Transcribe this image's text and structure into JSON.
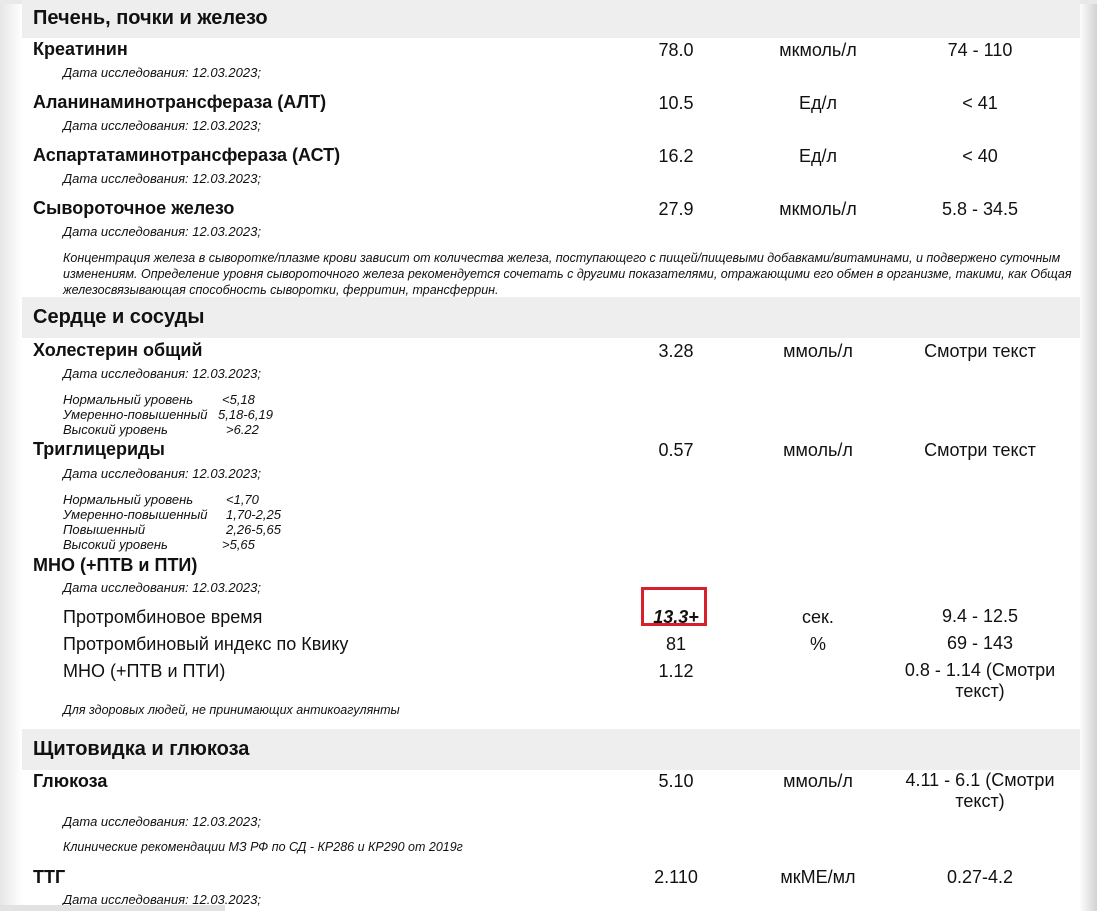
{
  "sections": {
    "liver": {
      "title": "Печень, почки и железо"
    },
    "heart": {
      "title": "Сердце и сосуды"
    },
    "thyroid": {
      "title": "Щитовидка и глюкоза"
    }
  },
  "date_label": "Дата исследования: 12.03.2023;",
  "tests": {
    "creatinine": {
      "name": "Креатинин",
      "value": "78.0",
      "unit": "мкмоль/л",
      "ref": "74 - 110"
    },
    "alt": {
      "name": "Аланинаминотрансфераза (АЛТ)",
      "value": "10.5",
      "unit": "Ед/л",
      "ref": "< 41"
    },
    "ast": {
      "name": "Аспартатаминотрансфераза (АСТ)",
      "value": "16.2",
      "unit": "Ед/л",
      "ref": "< 40"
    },
    "iron": {
      "name": "Сывороточное железо",
      "value": "27.9",
      "unit": "мкмоль/л",
      "ref": "5.8 - 34.5",
      "note": "Концентрация железа в сыворотке/плазме крови зависит от количества железа, поступающего с пищей/пищевыми добавками/витаминами, и подвержено суточным изменениям. Определение уровня сывороточного железа рекомендуется сочетать с другими показателями, отражающими его обмен в организме, такими, как Общая железосвязывающая способность сыворотки, ферритин, трансферрин."
    },
    "cholesterol": {
      "name": "Холестерин общий",
      "value": "3.28",
      "unit": "ммоль/л",
      "ref": "Смотри текст",
      "levels": [
        {
          "label": "Нормальный уровень",
          "value": "<5,18"
        },
        {
          "label": "Умеренно-повышенный",
          "value": "5,18-6,19"
        },
        {
          "label": "Высокий уровень",
          "value": ">6.22"
        }
      ]
    },
    "triglycerides": {
      "name": "Триглицериды",
      "value": "0.57",
      "unit": "ммоль/л",
      "ref": "Смотри текст",
      "levels": [
        {
          "label": "Нормальный уровень",
          "value": "<1,70"
        },
        {
          "label": "Умеренно-повышенный",
          "value": "1,70-2,25"
        },
        {
          "label": "Повышенный",
          "value": "2,26-5,65"
        },
        {
          "label": "Высокий уровень",
          "value": ">5,65"
        }
      ]
    },
    "inr_group": {
      "name": "МНО (+ПТВ и ПТИ)",
      "items": [
        {
          "name": "Протромбиновое время",
          "value": "13.3+",
          "unit": "сек.",
          "ref": "9.4 - 12.5"
        },
        {
          "name": "Протромбиновый индекс по Квику",
          "value": "81",
          "unit": "%",
          "ref": "69 - 143"
        },
        {
          "name": "МНО (+ПТВ и ПТИ)",
          "value": "1.12",
          "unit": "",
          "ref": "0.8 - 1.14 (Смотри текст)"
        }
      ],
      "note": "Для здоровых людей, не принимающих антикоагулянты"
    },
    "glucose": {
      "name": "Глюкоза",
      "value": "5.10",
      "unit": "ммоль/л",
      "ref": "4.11 - 6.1 (Смотри текст)",
      "note": "Клинические рекомендации МЗ РФ по СД - КР286 и КР290 от 2019г"
    },
    "tsh": {
      "name": "ТТГ",
      "value": "2.110",
      "unit": "мкМЕ/мл",
      "ref": "0.27-4.2"
    }
  },
  "colors": {
    "header_bg": "#eeeeee",
    "flag_border": "#d8202c"
  }
}
